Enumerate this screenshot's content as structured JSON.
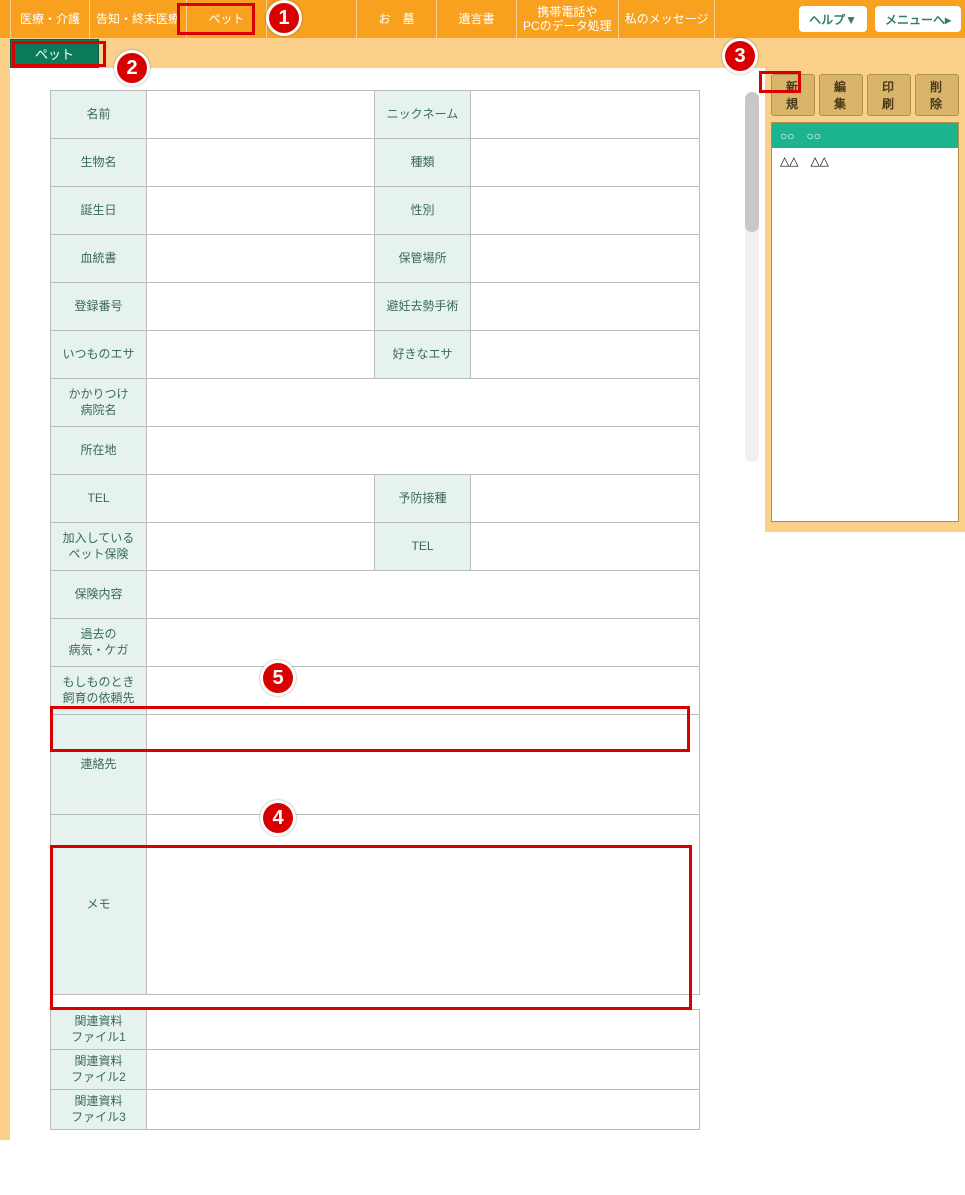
{
  "topbar": {
    "tabs": [
      "医療・介護",
      "告知・終末医療",
      "ペット",
      "お　墓",
      "遺言書",
      "携帯電話や\nPCのデータ処理",
      "私のメッセージ"
    ],
    "help": "ヘルプ▼",
    "menu": "メニューへ▸"
  },
  "subtab": "ペット",
  "actions": {
    "new": "新規",
    "edit": "編集",
    "print": "印刷",
    "delete": "削除"
  },
  "list": {
    "items": [
      "○○　○○",
      "△△　△△"
    ],
    "selected": 0
  },
  "form": {
    "rows_pair": [
      {
        "l1": "名前",
        "l2": "ニックネーム"
      },
      {
        "l1": "生物名",
        "l2": "種類"
      },
      {
        "l1": "誕生日",
        "l2": "性別"
      },
      {
        "l1": "血統書",
        "l2": "保管場所"
      },
      {
        "l1": "登録番号",
        "l2": "避妊去勢手術"
      },
      {
        "l1": "いつものエサ",
        "l2": "好きなエサ"
      }
    ],
    "rows_full": [
      "かかりつけ\n病院名",
      "所在地"
    ],
    "rows_pair2": [
      {
        "l1": "TEL",
        "l2": "予防接種"
      },
      {
        "l1": "加入している\nペット保険",
        "l2": "TEL"
      }
    ],
    "rows_full2": [
      "保険内容",
      "過去の\n病気・ケガ",
      "もしものとき\n飼育の依頼先",
      "連絡先"
    ],
    "memo_label": "メモ",
    "files": [
      "関連資料\nファイル1",
      "関連資料\nファイル2",
      "関連資料\nファイル3"
    ]
  },
  "callouts": {
    "c1": "1",
    "c2": "2",
    "c3": "3",
    "c4": "4",
    "c5": "5"
  }
}
